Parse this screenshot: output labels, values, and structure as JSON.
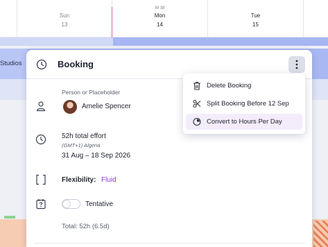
{
  "timeline": {
    "week_label": "W 38",
    "days": [
      {
        "name": "Sun",
        "num": "13"
      },
      {
        "name": "Mon",
        "num": "14"
      },
      {
        "name": "Tue",
        "num": "15"
      }
    ],
    "row_label": "Studios"
  },
  "panel": {
    "title": "Booking",
    "person_section_label": "Person or Placeholder",
    "person_name": "Amelie Spencer",
    "effort": "52h total effort",
    "timezone": "(GMT+1) Algeria",
    "date_range": "31 Aug – 18 Sep 2026",
    "flexibility_label": "Flexibility:",
    "flexibility_value": "Fluid",
    "tentative_label": "Tentative",
    "tentative_on": false,
    "total": "Total: 52h (6.5d)"
  },
  "menu": {
    "items": [
      {
        "label": "Delete Booking",
        "icon": "trash-icon"
      },
      {
        "label": "Split Booking Before 12 Sep",
        "icon": "scissors-icon"
      },
      {
        "label": "Convert to Hours Per Day",
        "icon": "clock-half-icon",
        "highlighted": true
      }
    ]
  },
  "colors": {
    "accent_purple": "#8c3bd6",
    "today_line": "#e05aa6",
    "booking_bar": "#a9b8f3"
  }
}
